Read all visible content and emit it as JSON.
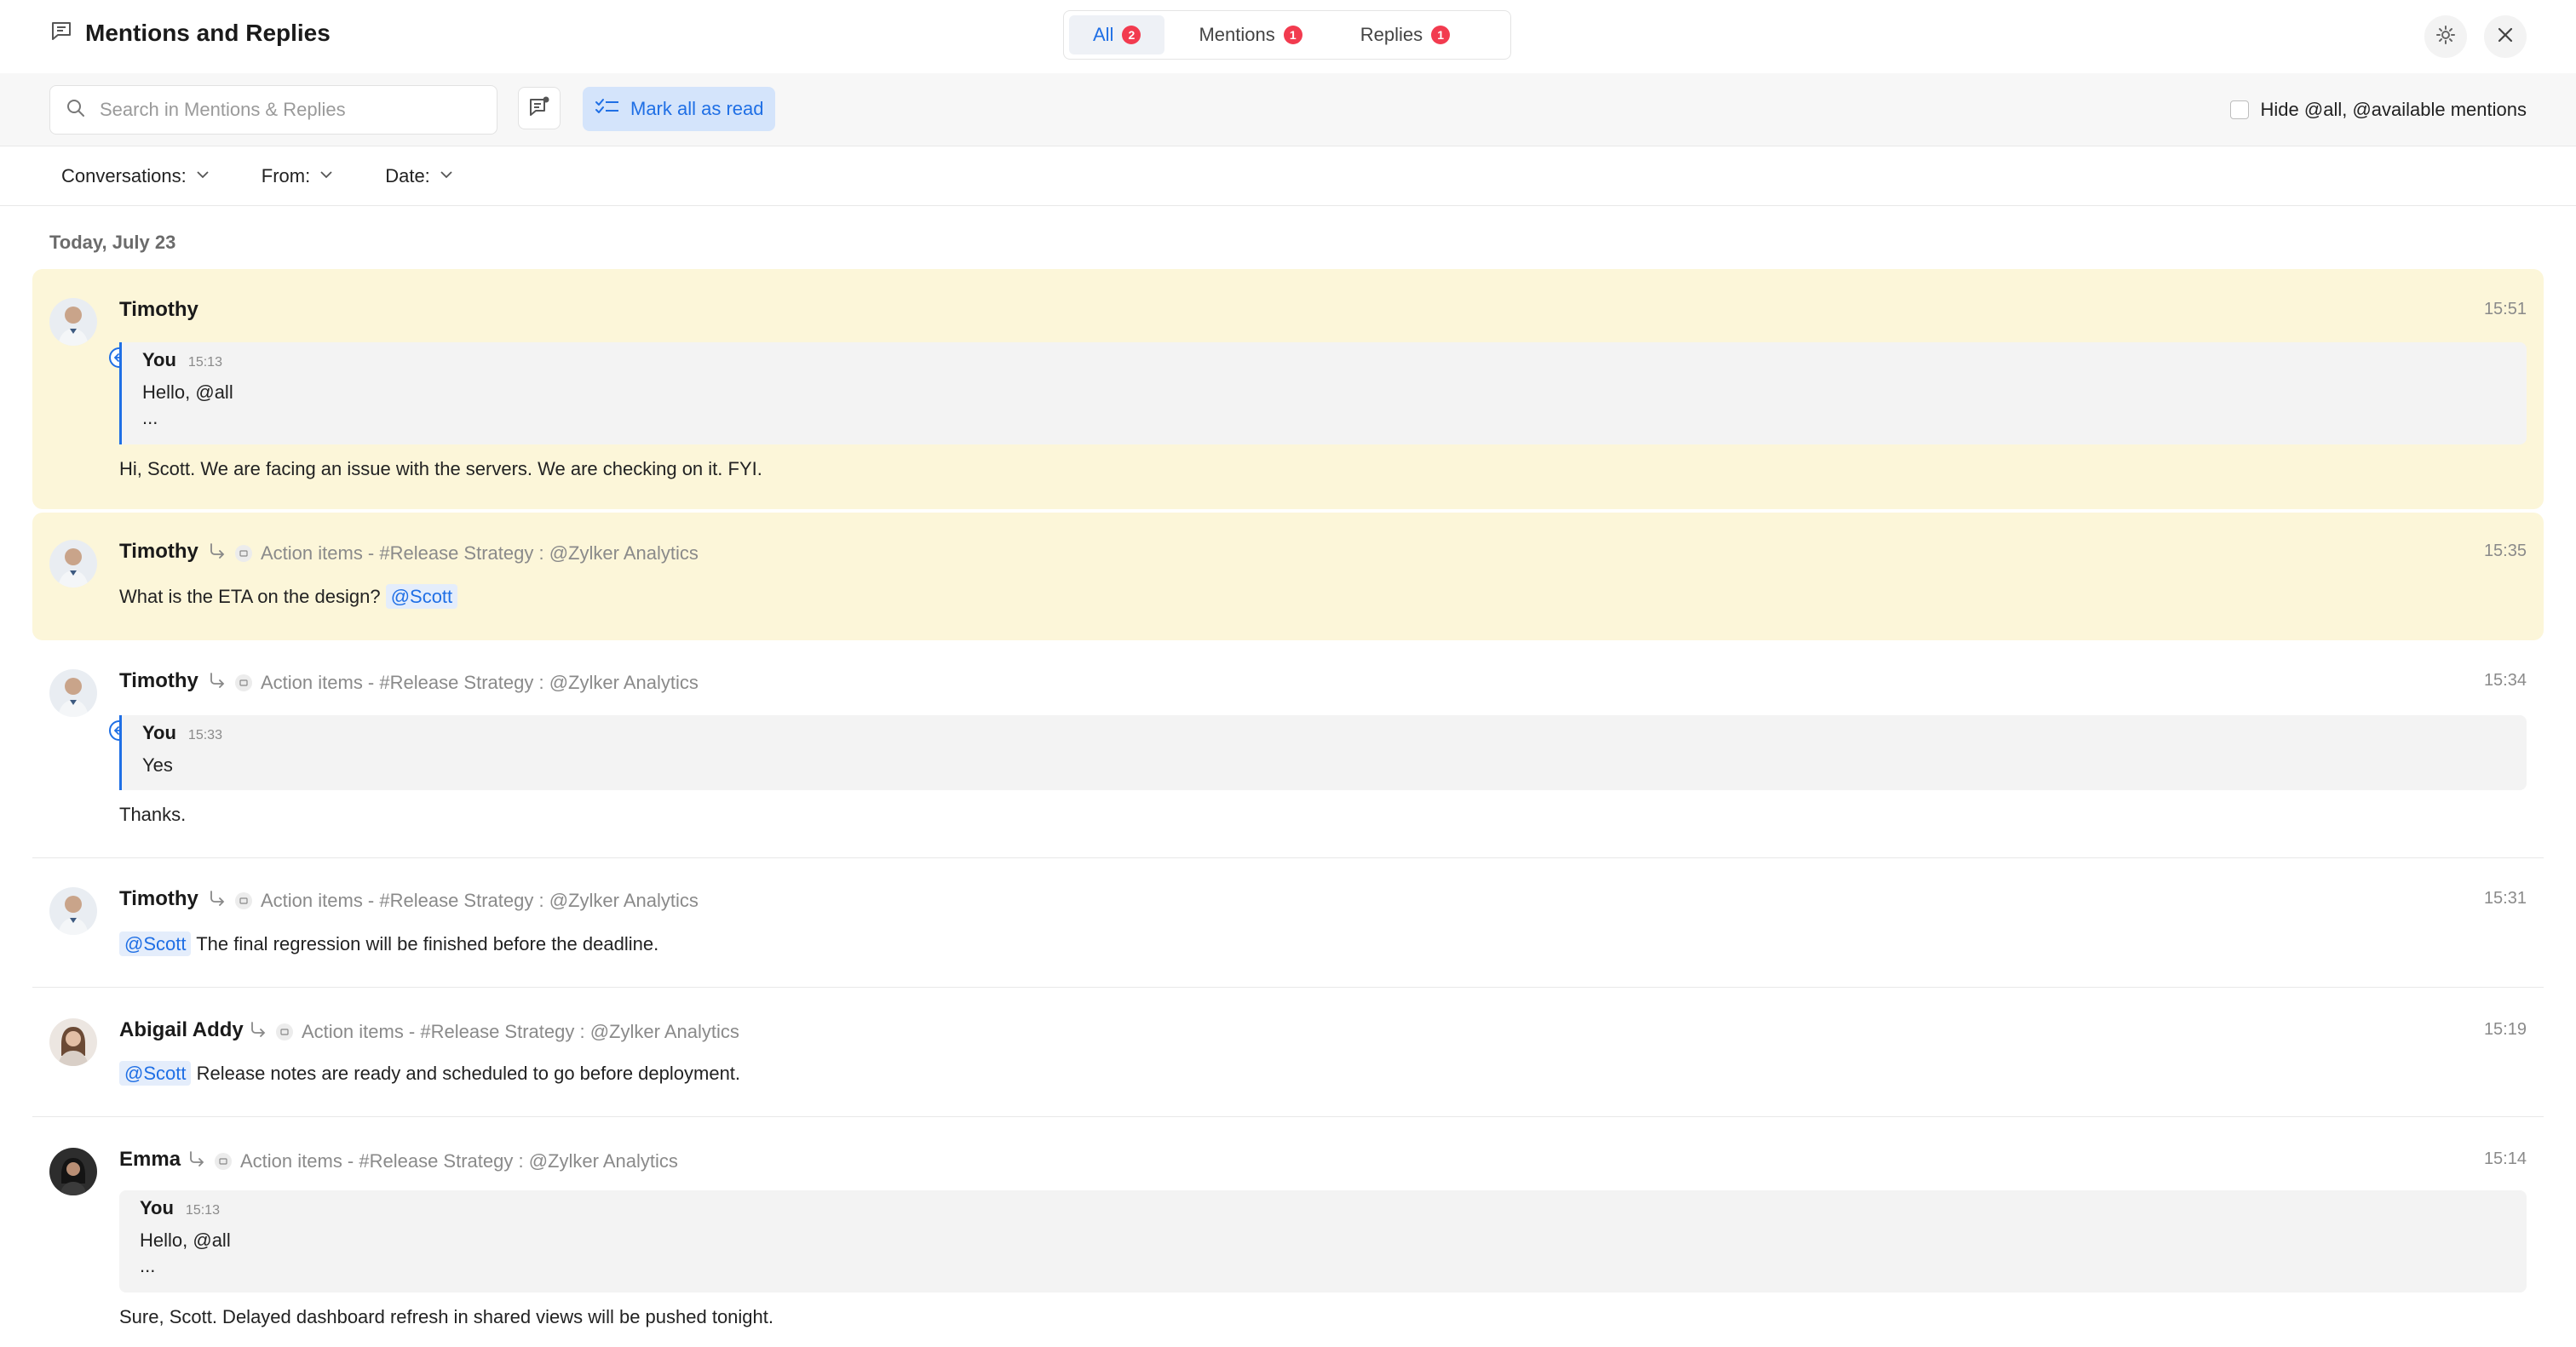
{
  "header": {
    "title": "Mentions and Replies",
    "tabs": [
      {
        "label": "All",
        "count": "2"
      },
      {
        "label": "Mentions",
        "count": "1"
      },
      {
        "label": "Replies",
        "count": "1"
      }
    ]
  },
  "toolbar": {
    "search_placeholder": "Search in Mentions & Replies",
    "mark_all_read": "Mark all as read",
    "hide_mentions": "Hide @all, @available mentions"
  },
  "filters": [
    {
      "label": "Conversations:"
    },
    {
      "label": "From:"
    },
    {
      "label": "Date:"
    }
  ],
  "day_label": "Today, July 23",
  "colors": {
    "accent": "#1f6fe5",
    "unread_bg": "#fcf6d9",
    "badge": "#f23b4f"
  },
  "messages": [
    {
      "author": "Timothy",
      "time": "15:51",
      "quote": {
        "author": "You",
        "time": "15:13",
        "text": "Hello, @all",
        "ellipsis": "..."
      },
      "text": "Hi, Scott. We are facing an issue with the servers. We are checking on it. FYI."
    },
    {
      "author": "Timothy",
      "context": "Action items - #Release Strategy : @Zylker Analytics",
      "time": "15:35",
      "text": "What is the ETA on the design?",
      "mention": "@Scott"
    },
    {
      "author": "Timothy",
      "context": "Action items - #Release Strategy : @Zylker Analytics",
      "time": "15:34",
      "quote": {
        "author": "You",
        "time": "15:33",
        "text": "Yes"
      },
      "text": "Thanks."
    },
    {
      "author": "Timothy",
      "context": "Action items - #Release Strategy : @Zylker Analytics",
      "time": "15:31",
      "mention": "@Scott",
      "text": "The final regression will be finished before the deadline."
    },
    {
      "author": "Abigail Addy",
      "context": "Action items - #Release Strategy : @Zylker Analytics",
      "time": "15:19",
      "mention": "@Scott",
      "text": "Release notes are ready and scheduled to go before deployment."
    },
    {
      "author": "Emma",
      "context": "Action items - #Release Strategy : @Zylker Analytics",
      "time": "15:14",
      "quote": {
        "author": "You",
        "time": "15:13",
        "text": "Hello, @all",
        "ellipsis": "..."
      },
      "text": "Sure, Scott. Delayed dashboard refresh in shared views will be pushed tonight."
    }
  ]
}
